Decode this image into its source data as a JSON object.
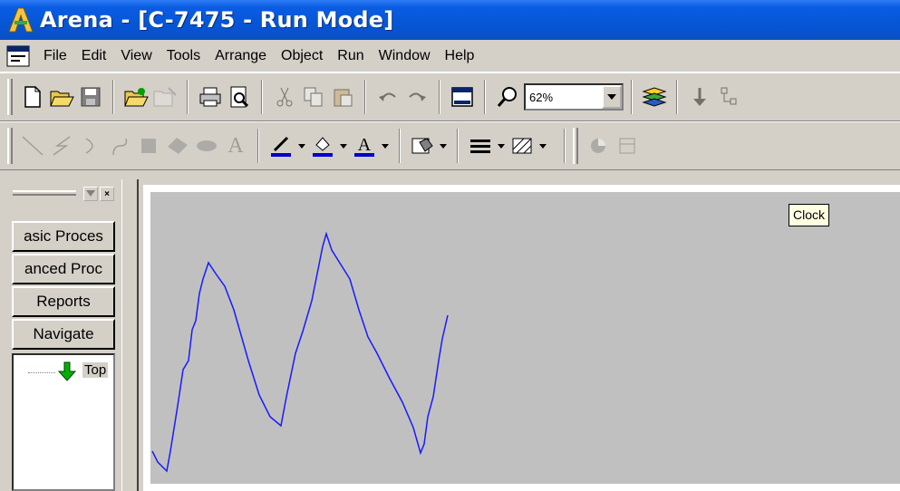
{
  "window": {
    "title": "Arena - [C-7475 - Run Mode]",
    "icon": "arena-app-icon"
  },
  "menubar": {
    "icon": "document-menu-icon",
    "items": [
      {
        "label": "File"
      },
      {
        "label": "Edit"
      },
      {
        "label": "View"
      },
      {
        "label": "Tools"
      },
      {
        "label": "Arrange"
      },
      {
        "label": "Object"
      },
      {
        "label": "Run"
      },
      {
        "label": "Window"
      },
      {
        "label": "Help"
      }
    ]
  },
  "toolbar": {
    "zoom_value": "62%",
    "tools": [
      "new-icon",
      "open-icon",
      "save-icon",
      "template-attach-icon",
      "template-detach-icon",
      "print-icon",
      "print-preview-icon",
      "cut-icon",
      "copy-icon",
      "paste-icon",
      "undo-icon",
      "redo-icon",
      "layers-window-icon",
      "zoom-icon",
      "layers-icon",
      "step-icon",
      "connect-icon"
    ]
  },
  "drawing_toolbar": {
    "tools": [
      "line-icon",
      "polyline-icon",
      "arc-icon",
      "bezier-icon",
      "box-icon",
      "polygon-icon",
      "ellipse-icon",
      "text-icon",
      "line-color-icon",
      "fill-color-icon",
      "text-color-icon",
      "window-background-icon",
      "line-style-icon",
      "fill-pattern-icon",
      "clock-icon",
      "date-icon"
    ],
    "text_tool_glyph": "A",
    "text_color_glyph": "A",
    "accent": "#0000cc"
  },
  "project_bar": {
    "close_glyph": "×",
    "buttons": [
      {
        "label": "asic Proces"
      },
      {
        "label": "anced Proc"
      },
      {
        "label": "Reports"
      },
      {
        "label": "Navigate"
      }
    ],
    "tree_item": "Top"
  },
  "canvas": {
    "tooltip": "Clock",
    "plot_background": "#c0c0c0",
    "line_color": "#1a1aff"
  }
}
